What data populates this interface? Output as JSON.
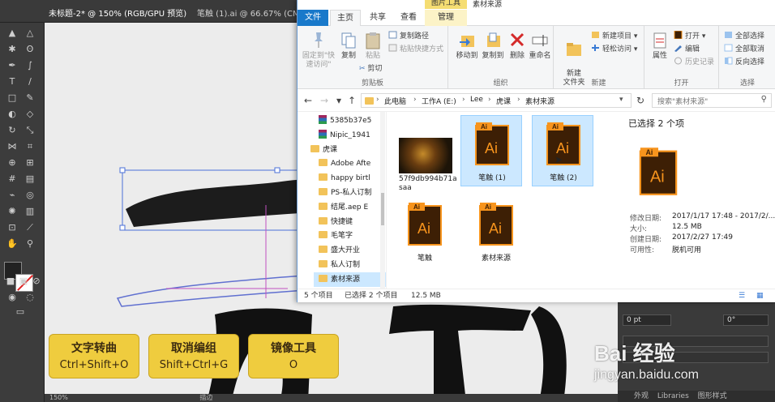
{
  "illustrator": {
    "tab_1": "未标题-2* @ 150% (RGB/GPU 预览)",
    "tab_2": "笔触 (1).ai @ 66.67% (CMYK",
    "zoom_status": "150%",
    "status_mode": "描边",
    "panel_value_1": "0 pt",
    "panel_value_2": "0°",
    "panel_tab_1": "外观",
    "panel_tab_2": "Libraries",
    "panel_tab_3": "图形样式"
  },
  "explorer": {
    "window_title": "素材来源",
    "context_tab": "图片工具",
    "ribbon_tabs": {
      "file": "文件",
      "home": "主页",
      "share": "共享",
      "view": "查看",
      "manage": "管理"
    },
    "ribbon": {
      "clipboard": {
        "group_label": "剪贴板",
        "pin": "固定到\"快速访问\"",
        "copy": "复制",
        "paste": "粘贴",
        "copy_path": "复制路径",
        "paste_shortcut": "粘贴快捷方式",
        "cut": "剪切"
      },
      "organize": {
        "group_label": "组织",
        "move_to": "移动到",
        "copy_to": "复制到",
        "delete": "删除",
        "rename": "重命名"
      },
      "new": {
        "group_label": "新建",
        "new_folder": "新建\n文件夹",
        "new_item": "新建项目",
        "easy_access": "轻松访问"
      },
      "open": {
        "group_label": "打开",
        "properties": "属性",
        "open": "打开",
        "edit": "编辑",
        "history": "历史记录"
      },
      "select": {
        "group_label": "选择",
        "select_all": "全部选择",
        "select_none": "全部取消",
        "invert": "反向选择"
      }
    },
    "address": {
      "crumbs": [
        "此电脑",
        "工作A (E:)",
        "Lee",
        "虎课",
        "素材来源"
      ]
    },
    "search_placeholder": "搜索\"素材来源\"",
    "nav_items": [
      {
        "label": "5385b37e5",
        "kind": "rar"
      },
      {
        "label": "Nipic_1941",
        "kind": "rar"
      },
      {
        "label": "虎课",
        "kind": "folder"
      },
      {
        "label": "Adobe Afte",
        "kind": "folder"
      },
      {
        "label": "happy birtl",
        "kind": "folder"
      },
      {
        "label": "PS-私人订制",
        "kind": "folder"
      },
      {
        "label": "结尾.aep E",
        "kind": "folder"
      },
      {
        "label": "快捷键",
        "kind": "folder"
      },
      {
        "label": "毛笔字",
        "kind": "folder"
      },
      {
        "label": "盛大开业",
        "kind": "folder"
      },
      {
        "label": "私人订制",
        "kind": "folder"
      },
      {
        "label": "素材来源",
        "kind": "folder"
      }
    ],
    "files": [
      {
        "label": "57f9db994b71a saa",
        "type": "image"
      },
      {
        "label": "笔触 (1)",
        "type": "ai"
      },
      {
        "label": "笔触 (2)",
        "type": "ai"
      },
      {
        "label": "笔触",
        "type": "ai"
      },
      {
        "label": "素材来源",
        "type": "ai"
      }
    ],
    "ai_icon_text": "Ai",
    "details": {
      "title": "已选择 2 个项",
      "modified_label": "修改日期:",
      "modified_value": "2017/1/17 17:48 - 2017/2/...",
      "size_label": "大小:",
      "size_value": "12.5 MB",
      "created_label": "创建日期:",
      "created_value": "2017/2/27 17:49",
      "availability_label": "可用性:",
      "availability_value": "脱机可用"
    },
    "status": {
      "count": "5 个项目",
      "selected": "已选择 2 个项目",
      "size": "12.5 MB"
    }
  },
  "shortcut_cards": [
    {
      "title": "文字转曲",
      "keys": "Ctrl+Shift+O"
    },
    {
      "title": "取消编组",
      "keys": "Shift+Ctrl+G"
    },
    {
      "title": "镜像工具",
      "keys": "O"
    }
  ],
  "watermark": {
    "main": "Bai 经验",
    "sub": "jingyan.baidu.com"
  },
  "colors": {
    "file_tab": "#1979ca",
    "selection": "#cce8ff",
    "ai_orange": "#f7941d",
    "ai_dark": "#3d1f05",
    "card_yellow": "#efcc3e"
  }
}
